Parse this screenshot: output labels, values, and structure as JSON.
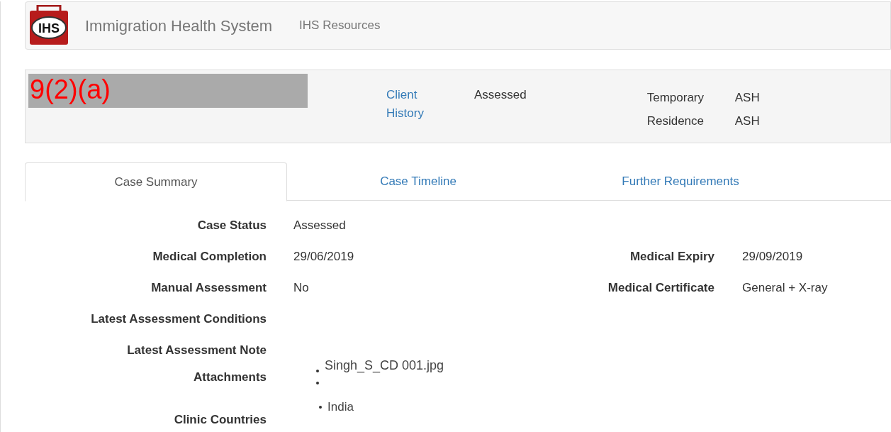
{
  "header": {
    "logo": {
      "text": "IHS"
    },
    "title": "Immigration Health System",
    "nav": [
      {
        "label": "IHS Resources"
      }
    ]
  },
  "client": {
    "redaction": "9(2)(a)",
    "link": "Client History",
    "status": "Assessed",
    "visa_label": "Temporary Residence",
    "visa_values": [
      "ASH",
      "ASH"
    ]
  },
  "tabs": [
    {
      "label": "Case Summary",
      "selected": true
    },
    {
      "label": "Case Timeline",
      "selected": false
    },
    {
      "label": "Further Requirements",
      "selected": false
    }
  ],
  "fields": [
    {
      "label": "Case Status",
      "value": "Assessed"
    },
    {
      "label": "Medical Completion",
      "value": "29/06/2019",
      "label_2": "Medical Expiry",
      "value_2": "29/09/2019"
    },
    {
      "label": "Manual Assessment",
      "value": "No",
      "label_2": "Medical Certificate",
      "value_2": "General + X-ray"
    },
    {
      "label": "Latest Assessment Conditions"
    },
    {
      "label": "Latest Assessment Note"
    }
  ],
  "attachments": {
    "label": "Attachments",
    "items": [
      {
        "kind": "file",
        "name": "Singh_S_CD 001.jpg"
      },
      {
        "kind": "blank"
      }
    ]
  },
  "clinic_countries": {
    "label": "Clinic Countries",
    "items": [
      "India"
    ]
  }
}
